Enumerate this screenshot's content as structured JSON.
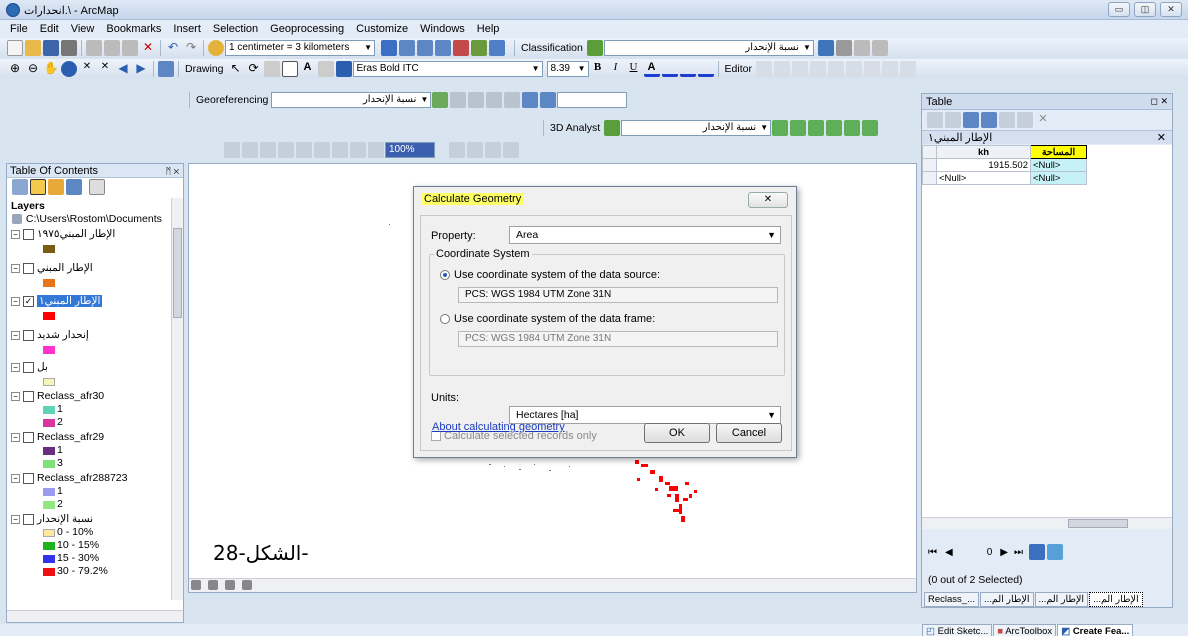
{
  "window": {
    "title": "انحدارات.\\ - ArcMap",
    "min": "▭",
    "max": "◫",
    "close": "✕"
  },
  "menu": [
    "File",
    "Edit",
    "View",
    "Bookmarks",
    "Insert",
    "Selection",
    "Geoprocessing",
    "Customize",
    "Windows",
    "Help"
  ],
  "toolbar": {
    "scale": "1 centimeter = 3 kilometers",
    "classification_label": "Classification",
    "classification_layer": "نسبة الإنحدار",
    "drawing_label": "Drawing",
    "font_name": "Eras Bold ITC",
    "font_size": "8.39",
    "bold": "B",
    "italic": "I",
    "underline": "U",
    "font_color": "A",
    "editor_label": "Editor",
    "georef_label": "Georeferencing",
    "georef_layer": "نسبة الإنحدار",
    "analyst_label": "3D Analyst",
    "analyst_layer": "نسبة الإنحدار",
    "zoom_pct": "100%"
  },
  "toc": {
    "title": "Table Of Contents",
    "pin": "ᛗ ✕",
    "layers_heading": "Layers",
    "path": "C:\\Users\\Rostom\\Documents",
    "items": [
      {
        "label": "الإطار المبني١٩٧٥",
        "color": "#7a5c12"
      },
      {
        "label": "الإطار المبني",
        "color": "#e8741a"
      },
      {
        "label": "الإطار المبني١",
        "color": "#ff0000",
        "selected": true
      },
      {
        "label": "إنحدار شديد",
        "color": "#ff33cc"
      },
      {
        "label": "بل",
        "color": "#f5f5bb"
      }
    ],
    "reclass30": {
      "label": "Reclass_afr30",
      "classes": [
        {
          "label": "1",
          "color": "#5fd3b8"
        },
        {
          "label": "2",
          "color": "#d9369e"
        }
      ]
    },
    "reclass29": {
      "label": "Reclass_afr29",
      "classes": [
        {
          "label": "1",
          "color": "#6b2d80"
        },
        {
          "label": "3",
          "color": "#80e07a"
        }
      ]
    },
    "reclass288723": {
      "label": "Reclass_afr288723",
      "classes": [
        {
          "label": "1",
          "color": "#9a9af0"
        },
        {
          "label": "2",
          "color": "#90e880"
        }
      ]
    },
    "slope": {
      "label": "نسبة الإنحدار",
      "classes": [
        {
          "label": "0 - 10%",
          "color": "#ffe89a"
        },
        {
          "label": "10 - 15%",
          "color": "#1eb31e"
        },
        {
          "label": "15 - 30%",
          "color": "#3333ee"
        },
        {
          "label": "30 - 79.2%",
          "color": "#ee1111"
        }
      ]
    }
  },
  "map": {
    "figure_caption": "الشكل-28-"
  },
  "dialog": {
    "title": "Calculate Geometry",
    "close": "✕",
    "property_label": "Property:",
    "property_value": "Area",
    "coord_group": "Coordinate System",
    "radio1": "Use coordinate system of the data source:",
    "radio1_value": "PCS: WGS 1984 UTM Zone 31N",
    "radio2": "Use coordinate system of the data frame:",
    "radio2_value": "PCS: WGS 1984 UTM Zone 31N",
    "units_label": "Units:",
    "units_value": "Hectares [ha]",
    "selected_only": "Calculate selected records only",
    "about_link": "About calculating geometry",
    "ok": "OK",
    "cancel": "Cancel"
  },
  "table": {
    "title": "Table",
    "layer_tab": "الإطار المبني١",
    "columns": [
      "kh",
      "المساحة"
    ],
    "rows": [
      [
        "1915.502",
        "<Null>"
      ],
      [
        "<Null>",
        "<Null>"
      ]
    ],
    "record_pos": "0",
    "selected_text": "(0 out of 2 Selected)",
    "tabs": [
      "Reclass_...",
      "...الإطار الم",
      "...الإطار الم",
      "...الإطار الم"
    ]
  },
  "bottom_tabs": [
    "Edit Sketc...",
    "ArcToolbox",
    "Create Fea..."
  ]
}
